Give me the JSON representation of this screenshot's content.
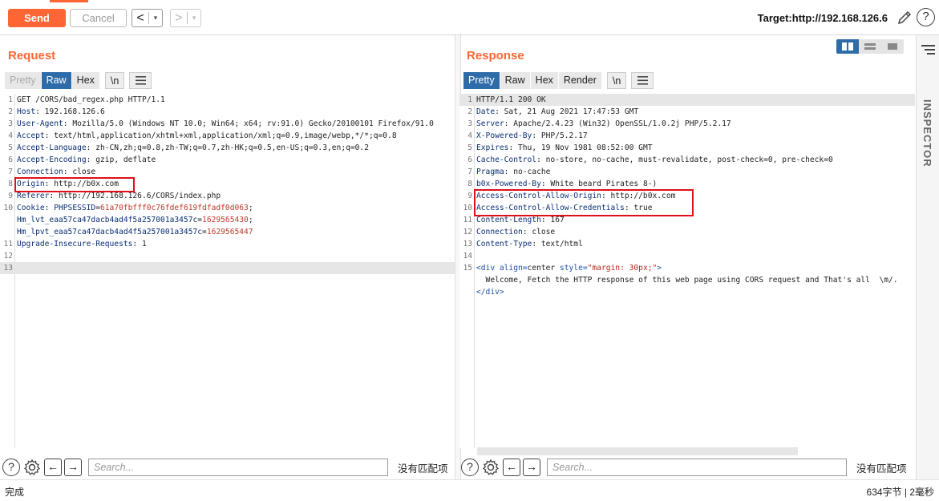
{
  "toolbar": {
    "send_label": "Send",
    "cancel_label": "Cancel",
    "back_arrow": "<",
    "forward_arrow": ">",
    "dropdown": "▾",
    "target_label": "Target:http://192.168.126.6",
    "help_glyph": "?",
    "accent_color": "#ff6633"
  },
  "request": {
    "title": "Request",
    "tabs": [
      "Pretty",
      "Raw",
      "Hex",
      "\\n"
    ],
    "active_tab": "Raw",
    "lines": [
      {
        "n": "1",
        "parts": [
          [
            "GET /CORS/bad_regex.php HTTP/1.1",
            "plain"
          ]
        ]
      },
      {
        "n": "2",
        "parts": [
          [
            "Host",
            "hdr"
          ],
          [
            ": 192.168.126.6",
            "plain"
          ]
        ]
      },
      {
        "n": "3",
        "parts": [
          [
            "User-Agent",
            "hdr"
          ],
          [
            ": Mozilla/5.0 (Windows NT 10.0; Win64; x64; rv:91.0) Gecko/20100101 Firefox/91.0",
            "plain"
          ]
        ]
      },
      {
        "n": "4",
        "parts": [
          [
            "Accept",
            "hdr"
          ],
          [
            ": text/html,application/xhtml+xml,application/xml;q=0.9,image/webp,*/*;q=0.8",
            "plain"
          ]
        ]
      },
      {
        "n": "5",
        "parts": [
          [
            "Accept-Language",
            "hdr"
          ],
          [
            ": zh-CN,zh;q=0.8,zh-TW;q=0.7,zh-HK;q=0.5,en-US;q=0.3,en;q=0.2",
            "plain"
          ]
        ]
      },
      {
        "n": "6",
        "parts": [
          [
            "Accept-Encoding",
            "hdr"
          ],
          [
            ": gzip, deflate",
            "plain"
          ]
        ]
      },
      {
        "n": "7",
        "parts": [
          [
            "Connection",
            "hdr"
          ],
          [
            ": close",
            "plain"
          ]
        ]
      },
      {
        "n": "8",
        "parts": [
          [
            "Origin",
            "hdr"
          ],
          [
            ": http://b0x.com",
            "plain"
          ]
        ]
      },
      {
        "n": "9",
        "parts": [
          [
            "Referer",
            "hdr"
          ],
          [
            ": http://192.168.126.6/CORS/index.php",
            "plain"
          ]
        ]
      },
      {
        "n": "10",
        "parts": [
          [
            "Cookie",
            "hdr"
          ],
          [
            ": ",
            "plain"
          ],
          [
            "PHPSESSID",
            "hdr"
          ],
          [
            "=",
            "plain"
          ],
          [
            "61a70fbfff0c76fdef619fdfadf0d063",
            "red"
          ],
          [
            ";",
            "plain"
          ]
        ]
      },
      {
        "n": "",
        "parts": [
          [
            "Hm_lvt_eaa57ca47dacb4ad4f5a257001a3457c",
            "hdr"
          ],
          [
            "=",
            "plain"
          ],
          [
            "1629565430",
            "red"
          ],
          [
            ";",
            "plain"
          ]
        ]
      },
      {
        "n": "",
        "parts": [
          [
            "Hm_lpvt_eaa57ca47dacb4ad4f5a257001a3457c",
            "hdr"
          ],
          [
            "=",
            "plain"
          ],
          [
            "1629565447",
            "red"
          ]
        ]
      },
      {
        "n": "11",
        "parts": [
          [
            "Upgrade-Insecure-Requests",
            "hdr"
          ],
          [
            ": 1",
            "plain"
          ]
        ]
      },
      {
        "n": "12",
        "parts": []
      },
      {
        "n": "13",
        "parts": []
      }
    ],
    "search_placeholder": "Search...",
    "no_match": "没有匹配项"
  },
  "response": {
    "title": "Response",
    "tabs": [
      "Pretty",
      "Raw",
      "Hex",
      "Render",
      "\\n"
    ],
    "active_tab": "Pretty",
    "lines": [
      {
        "n": "1",
        "parts": [
          [
            "HTTP/1.1 200 OK",
            "plain"
          ]
        ]
      },
      {
        "n": "2",
        "parts": [
          [
            "Date",
            "hdr"
          ],
          [
            ": Sat, 21 Aug 2021 17:47:53 GMT",
            "plain"
          ]
        ]
      },
      {
        "n": "3",
        "parts": [
          [
            "Server",
            "hdr"
          ],
          [
            ": Apache/2.4.23 (Win32) OpenSSL/1.0.2j PHP/5.2.17",
            "plain"
          ]
        ]
      },
      {
        "n": "4",
        "parts": [
          [
            "X-Powered-By",
            "hdr"
          ],
          [
            ": PHP/5.2.17",
            "plain"
          ]
        ]
      },
      {
        "n": "5",
        "parts": [
          [
            "Expires",
            "hdr"
          ],
          [
            ": Thu, 19 Nov 1981 08:52:00 GMT",
            "plain"
          ]
        ]
      },
      {
        "n": "6",
        "parts": [
          [
            "Cache-Control",
            "hdr"
          ],
          [
            ": no-store, no-cache, must-revalidate, post-check=0, pre-check=0",
            "plain"
          ]
        ]
      },
      {
        "n": "7",
        "parts": [
          [
            "Pragma",
            "hdr"
          ],
          [
            ": no-cache",
            "plain"
          ]
        ]
      },
      {
        "n": "8",
        "parts": [
          [
            "b0x-Powered-By",
            "hdr"
          ],
          [
            ": White beard Pirates 8-)",
            "plain"
          ]
        ]
      },
      {
        "n": "9",
        "parts": [
          [
            "Access-Control-Allow-Origin",
            "hdr"
          ],
          [
            ": http://b0x.com",
            "plain"
          ]
        ]
      },
      {
        "n": "10",
        "parts": [
          [
            "Access-Control-Allow-Credentials",
            "hdr"
          ],
          [
            ": true",
            "plain"
          ]
        ]
      },
      {
        "n": "11",
        "parts": [
          [
            "Content-Length",
            "hdr"
          ],
          [
            ": 167",
            "plain"
          ]
        ]
      },
      {
        "n": "12",
        "parts": [
          [
            "Connection",
            "hdr"
          ],
          [
            ": close",
            "plain"
          ]
        ]
      },
      {
        "n": "13",
        "parts": [
          [
            "Content-Type",
            "hdr"
          ],
          [
            ": text/html",
            "plain"
          ]
        ]
      },
      {
        "n": "14",
        "parts": []
      },
      {
        "n": "15",
        "parts": [
          [
            "<div align=",
            "tag"
          ],
          [
            "center",
            "plain"
          ],
          [
            " style=",
            "tag"
          ],
          [
            "\"margin: 30px;\"",
            "str"
          ],
          [
            ">",
            "tag"
          ]
        ]
      },
      {
        "n": "",
        "parts": [
          [
            "  Welcome, Fetch the HTTP response of this web page using CORS request and That's all  \\m/.",
            "plain"
          ]
        ]
      },
      {
        "n": "",
        "parts": [
          [
            "</div>",
            "tag"
          ]
        ]
      }
    ],
    "search_placeholder": "Search...",
    "no_match": "没有匹配项"
  },
  "inspector": {
    "label": "INSPECTOR"
  },
  "status": {
    "left": "完成",
    "right": "634字节 | 2毫秒"
  }
}
